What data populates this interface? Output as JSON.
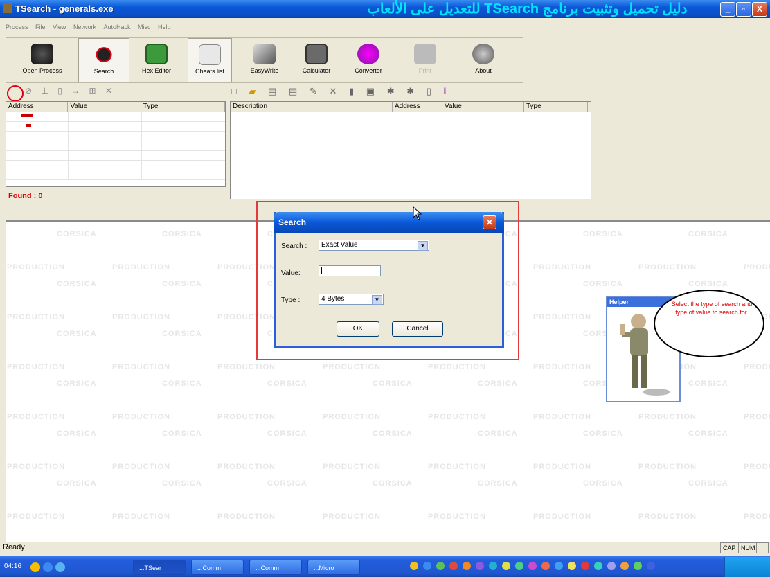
{
  "window": {
    "title": "TSearch - generals.exe",
    "banner": "دليل تحميل وتثبيت برنامج TSearch للتعديل على الألعاب",
    "controls": [
      "_",
      "▫",
      "X"
    ]
  },
  "menu": [
    "Process",
    "File",
    "View",
    "Network",
    "AutoHack",
    "Misc",
    "Help"
  ],
  "toolbar": [
    {
      "label": "Open Process",
      "icon": "chip-icon"
    },
    {
      "label": "Search",
      "icon": "search-chip-icon"
    },
    {
      "label": "Hex Editor",
      "icon": "hex-editor-icon"
    },
    {
      "label": "Cheats list",
      "icon": "cheats-list-icon"
    },
    {
      "label": "EasyWrite",
      "icon": "easywrite-icon"
    },
    {
      "label": "Calculator",
      "icon": "calculator-icon"
    },
    {
      "label": "Converter",
      "icon": "converter-icon"
    },
    {
      "label": "Print",
      "icon": "print-icon"
    },
    {
      "label": "About",
      "icon": "about-icon"
    }
  ],
  "left_grid": {
    "columns": [
      "Address",
      "Value",
      "Type"
    ],
    "found_label": "Found : 0"
  },
  "right_grid": {
    "columns": [
      "Description",
      "Address",
      "Value",
      "Type"
    ]
  },
  "watermark": {
    "line1": "CORSICA",
    "line2": "PRODUCTION"
  },
  "dialog": {
    "title": "Search",
    "search_label": "Search :",
    "search_value": "Exact Value",
    "value_label": "Value:",
    "value_input": "",
    "type_label": "Type :",
    "type_value": "4 Bytes",
    "ok": "OK",
    "cancel": "Cancel"
  },
  "helper": {
    "title": "Helper",
    "message": "Select the type of search and type of value to search for."
  },
  "status": {
    "text": "Ready",
    "cap": "CAP",
    "num": "NUM"
  },
  "taskbar": {
    "clock": "04:16",
    "tasks": [
      "...TSear",
      "...Comm",
      "...Comm",
      "...Micro"
    ]
  },
  "colors": {
    "accent": "#0a58d8",
    "highlight_red": "#e43a3a",
    "found_red": "#dd0000"
  }
}
